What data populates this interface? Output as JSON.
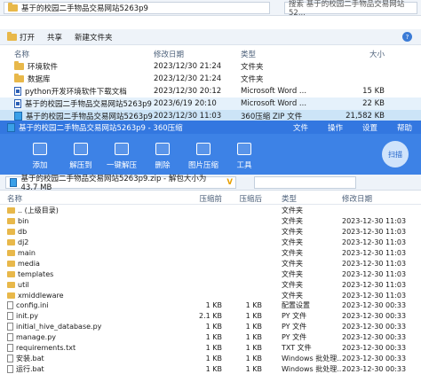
{
  "explorer": {
    "address_path": "基于的校园二手物品交易网站5263p9",
    "search_placeholder": "搜索 基于的校园二手物品交易网站52...",
    "toolbar": {
      "open": "打开",
      "share": "共享",
      "new_folder": "新建文件夹",
      "help": "?"
    },
    "columns": [
      "名称",
      "修改日期",
      "类型",
      "大小"
    ],
    "files": [
      {
        "name": "环境软件",
        "date": "2023/12/30 21:24",
        "type": "文件夹",
        "size": "",
        "icon": "folder",
        "state": ""
      },
      {
        "name": "数据库",
        "date": "2023/12/30 21:24",
        "type": "文件夹",
        "size": "",
        "icon": "folder",
        "state": ""
      },
      {
        "name": "python开发环境软件下载文档",
        "date": "2023/12/30 20:12",
        "type": "Microsoft Word ...",
        "size": "15 KB",
        "icon": "doc",
        "state": ""
      },
      {
        "name": "基于的校园二手物品交易网站5263p9",
        "date": "2023/6/19 20:10",
        "type": "Microsoft Word ...",
        "size": "22 KB",
        "icon": "doc",
        "state": "hover"
      },
      {
        "name": "基于的校园二手物品交易网站5263p9",
        "date": "2023/12/30 11:03",
        "type": "360压缩 ZIP 文件",
        "size": "21,582 KB",
        "icon": "zip",
        "state": "selected"
      }
    ]
  },
  "zip": {
    "title": "基于的校园二手物品交易网站5263p9 - 360压缩",
    "menu": [
      "文件",
      "操作",
      "设置",
      "帮助"
    ],
    "ribbon": [
      "添加",
      "解压到",
      "一键解压",
      "删除",
      "图片压缩",
      "工具"
    ],
    "scan": "扫描",
    "path": "基于的校园二手物品交易网站5263p9.zip - 解包大小为 43.7 MB",
    "columns": [
      "名称",
      "压缩前",
      "压缩后",
      "类型",
      "修改日期"
    ],
    "rows": [
      {
        "name": ".. (上级目录)",
        "size": "",
        "csize": "",
        "type": "文件夹",
        "date": "",
        "icon": "folder"
      },
      {
        "name": "bin",
        "size": "",
        "csize": "",
        "type": "文件夹",
        "date": "2023-12-30 11:03",
        "icon": "folder"
      },
      {
        "name": "db",
        "size": "",
        "csize": "",
        "type": "文件夹",
        "date": "2023-12-30 11:03",
        "icon": "folder"
      },
      {
        "name": "dj2",
        "size": "",
        "csize": "",
        "type": "文件夹",
        "date": "2023-12-30 11:03",
        "icon": "folder"
      },
      {
        "name": "main",
        "size": "",
        "csize": "",
        "type": "文件夹",
        "date": "2023-12-30 11:03",
        "icon": "folder"
      },
      {
        "name": "media",
        "size": "",
        "csize": "",
        "type": "文件夹",
        "date": "2023-12-30 11:03",
        "icon": "folder"
      },
      {
        "name": "templates",
        "size": "",
        "csize": "",
        "type": "文件夹",
        "date": "2023-12-30 11:03",
        "icon": "folder"
      },
      {
        "name": "util",
        "size": "",
        "csize": "",
        "type": "文件夹",
        "date": "2023-12-30 11:03",
        "icon": "folder"
      },
      {
        "name": "xmiddleware",
        "size": "",
        "csize": "",
        "type": "文件夹",
        "date": "2023-12-30 11:03",
        "icon": "folder"
      },
      {
        "name": "config.ini",
        "size": "1 KB",
        "csize": "1 KB",
        "type": "配置设置",
        "date": "2023-12-30 00:33",
        "icon": "doc"
      },
      {
        "name": "init.py",
        "size": "2.1 KB",
        "csize": "1 KB",
        "type": "PY 文件",
        "date": "2023-12-30 00:33",
        "icon": "doc"
      },
      {
        "name": "initial_hive_database.py",
        "size": "1 KB",
        "csize": "1 KB",
        "type": "PY 文件",
        "date": "2023-12-30 00:33",
        "icon": "doc"
      },
      {
        "name": "manage.py",
        "size": "1 KB",
        "csize": "1 KB",
        "type": "PY 文件",
        "date": "2023-12-30 00:33",
        "icon": "doc"
      },
      {
        "name": "requirements.txt",
        "size": "1 KB",
        "csize": "1 KB",
        "type": "TXT 文件",
        "date": "2023-12-30 00:33",
        "icon": "doc"
      },
      {
        "name": "安装.bat",
        "size": "1 KB",
        "csize": "1 KB",
        "type": "Windows 批处理...",
        "date": "2023-12-30 00:33",
        "icon": "doc"
      },
      {
        "name": "运行.bat",
        "size": "1 KB",
        "csize": "1 KB",
        "type": "Windows 批处理...",
        "date": "2023-12-30 00:33",
        "icon": "doc"
      }
    ]
  }
}
